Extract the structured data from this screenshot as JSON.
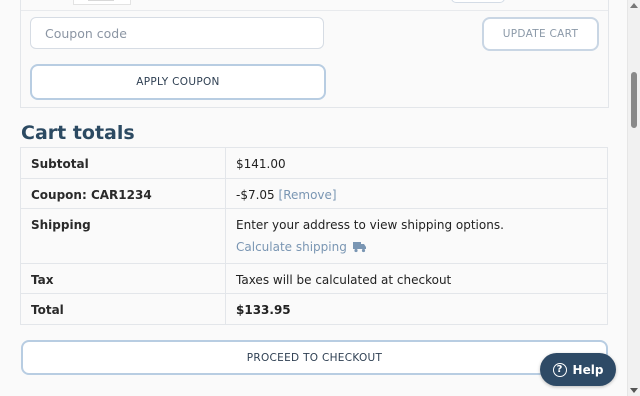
{
  "coupon": {
    "placeholder": "Coupon code",
    "value": "",
    "apply_label": "APPLY COUPON",
    "update_label": "UPDATE CART"
  },
  "totals": {
    "title": "Cart totals",
    "subtotal_label": "Subtotal",
    "subtotal_value": "$141.00",
    "coupon_label": "Coupon: CAR1234",
    "coupon_value": "-$7.05",
    "coupon_remove": "[Remove]",
    "shipping_label": "Shipping",
    "shipping_text": "Enter your address to view shipping options.",
    "shipping_link": "Calculate shipping",
    "shipping_icon": "truck-icon",
    "tax_label": "Tax",
    "tax_value": "Taxes will be calculated at checkout",
    "total_label": "Total",
    "total_value": "$133.95"
  },
  "checkout": {
    "label": "PROCEED TO CHECKOUT"
  },
  "help": {
    "label": "Help",
    "icon": "question-icon",
    "glyph": "?"
  },
  "colors": {
    "accent": "#2c4a62",
    "link": "#7a96b3",
    "button_border": "#b8cde2",
    "help_bg": "#2e4a66"
  }
}
